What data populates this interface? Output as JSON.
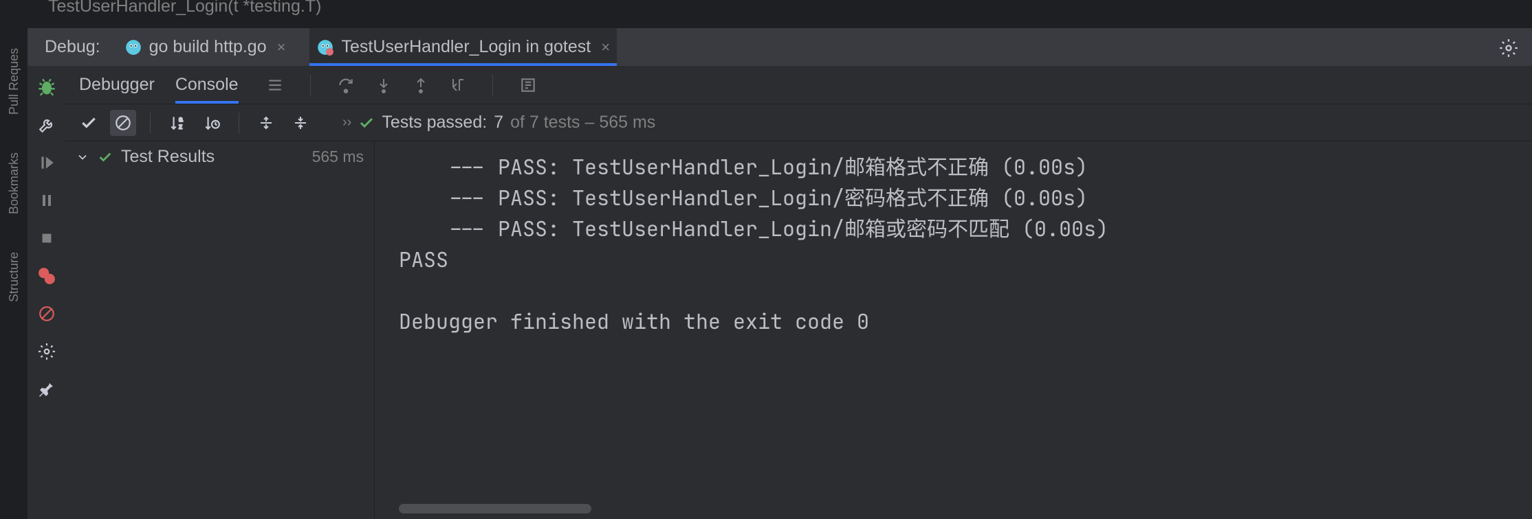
{
  "editor": {
    "breadcrumb": "TestUserHandler_Login(t *testing.T)"
  },
  "leftRail": {
    "items": [
      "Pull Reques",
      "Bookmarks",
      "Structure"
    ]
  },
  "debugPanel": {
    "label": "Debug:",
    "tabs": [
      {
        "label": "go build http.go"
      },
      {
        "label": "TestUserHandler_Login in gotest"
      }
    ]
  },
  "subTabs": {
    "debugger": "Debugger",
    "console": "Console"
  },
  "testSummary": {
    "label": "Tests passed:",
    "passed": "7",
    "ofText": "of 7 tests – 565 ms"
  },
  "tree": {
    "root": {
      "label": "Test Results",
      "time": "565 ms"
    }
  },
  "console": {
    "lines": [
      "    --- PASS: TestUserHandler_Login/邮箱格式不正确 (0.00s)",
      "    --- PASS: TestUserHandler_Login/密码格式不正确 (0.00s)",
      "    --- PASS: TestUserHandler_Login/邮箱或密码不匹配 (0.00s)",
      "PASS",
      "",
      "Debugger finished with the exit code 0"
    ]
  }
}
